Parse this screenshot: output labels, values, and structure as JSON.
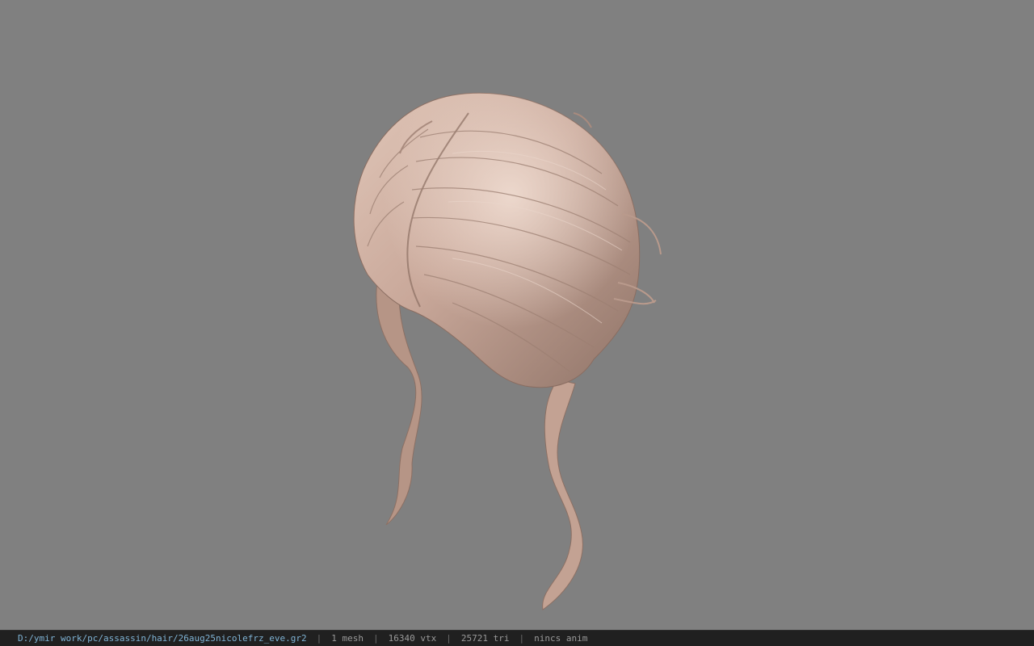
{
  "viewer": {
    "background_color": "#808080",
    "model_name": "hair-mesh",
    "hair_color": "#c9a89a"
  },
  "statusbar": {
    "file_path": "D:/ymir work/pc/assassin/hair/26aug25nicolefrz_eve.gr2",
    "separator": "|",
    "mesh_count": "1 mesh",
    "vertex_count": "16340 vtx",
    "triangle_count": "25721 tri",
    "anim_status": "nincs anim"
  }
}
